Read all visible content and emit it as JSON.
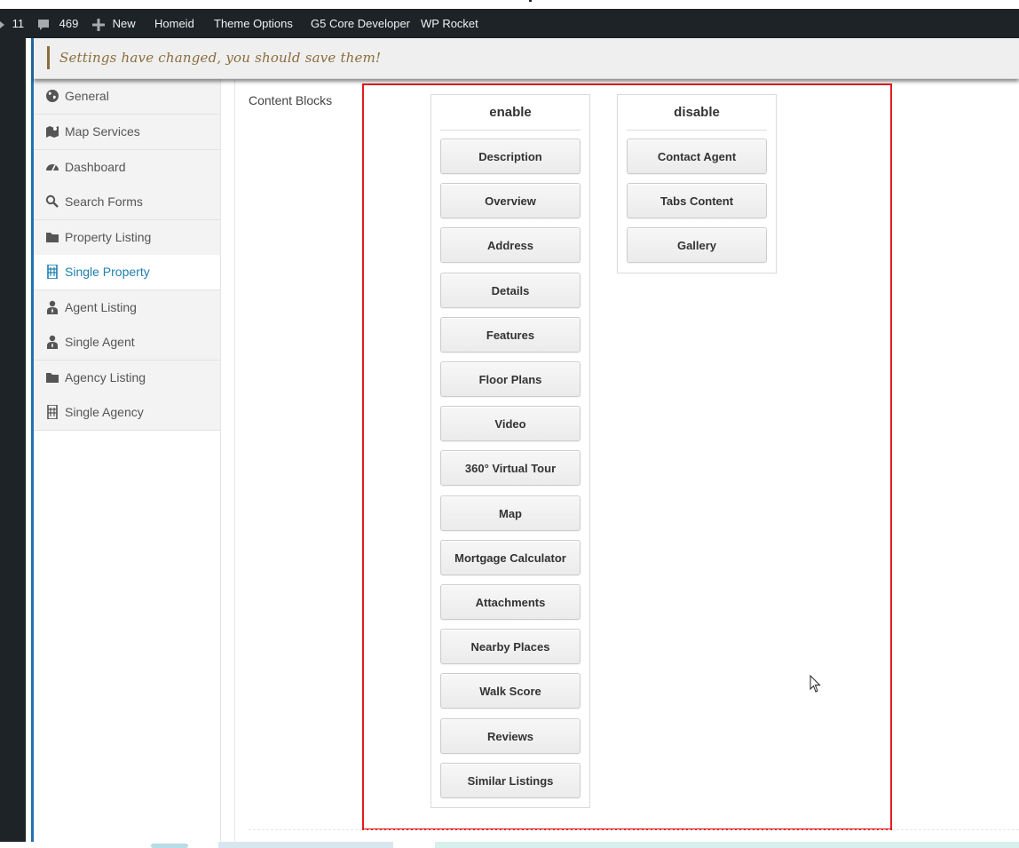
{
  "adminbar": {
    "updates_count": "11",
    "comments_count": "469",
    "new_label": "New",
    "menu": [
      "Homeid",
      "Theme Options",
      "G5 Core Developer",
      "WP Rocket"
    ]
  },
  "notice": {
    "text": "Settings have changed, you should save them!"
  },
  "sidebar": {
    "items": [
      {
        "label": "General",
        "icon": "globe-icon"
      },
      {
        "label": "Map Services",
        "icon": "map-icon"
      },
      {
        "label": "Dashboard",
        "icon": "dashboard-icon"
      },
      {
        "label": "Search Forms",
        "icon": "search-icon"
      },
      {
        "label": "Property Listing",
        "icon": "folder-icon"
      },
      {
        "label": "Single Property",
        "icon": "building-icon",
        "active": true
      },
      {
        "label": "Agent Listing",
        "icon": "user-tie-icon"
      },
      {
        "label": "Single Agent",
        "icon": "user-tie-icon"
      },
      {
        "label": "Agency Listing",
        "icon": "folder-icon"
      },
      {
        "label": "Single Agency",
        "icon": "building-icon"
      }
    ]
  },
  "field": {
    "label": "Content Blocks"
  },
  "sorter": {
    "enable": {
      "title": "enable",
      "items": [
        "Description",
        "Overview",
        "Address",
        "Details",
        "Features",
        "Floor Plans",
        "Video",
        "360° Virtual Tour",
        "Map",
        "Mortgage Calculator",
        "Attachments",
        "Nearby Places",
        "Walk Score",
        "Reviews",
        "Similar Listings"
      ]
    },
    "disable": {
      "title": "disable",
      "items": [
        "Contact Agent",
        "Tabs Content",
        "Gallery"
      ]
    }
  },
  "colors": {
    "admin_bar": "#1d2327",
    "active_link": "#1e7fb0",
    "notice_text": "#8a6d3b",
    "highlight_border": "#e21c1c"
  }
}
